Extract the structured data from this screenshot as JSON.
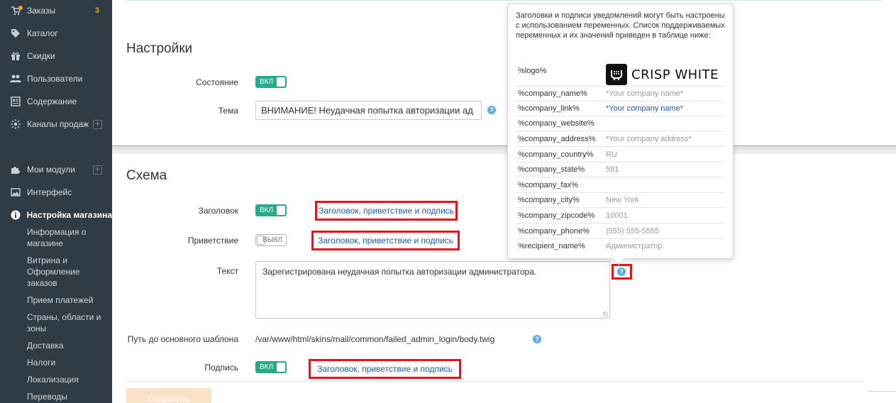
{
  "sidebar": {
    "items": [
      {
        "label": "Заказы",
        "icon": "orders-icon",
        "badge": "3"
      },
      {
        "label": "Каталог",
        "icon": "tag-icon"
      },
      {
        "label": "Скидки",
        "icon": "gift-icon"
      },
      {
        "label": "Пользователи",
        "icon": "users-icon"
      },
      {
        "label": "Содержание",
        "icon": "content-icon"
      },
      {
        "label": "Каналы продаж",
        "icon": "sales-channels-icon"
      },
      {
        "label": "Мои модули",
        "icon": "puzzle-icon"
      },
      {
        "label": "Интерфейс",
        "icon": "image-icon"
      },
      {
        "label": "Настройка магазина",
        "icon": "info-icon"
      }
    ],
    "subitems": [
      "Информация о магазине",
      "Витрина и Оформление заказов",
      "Прием платежей",
      "Страны, области и зоны",
      "Доставка",
      "Налоги",
      "Локализация",
      "Переводы"
    ],
    "plus": "+"
  },
  "settings": {
    "title": "Настройки",
    "state_label": "Состояние",
    "state_toggle": "ВКЛ",
    "subject_label": "Тема",
    "subject_value": "ВНИМАНИЕ! Неудачная попытка авторизации ад"
  },
  "schema": {
    "title": "Схема",
    "header_label": "Заголовок",
    "header_toggle": "ВКЛ",
    "header_link": "Заголовок, приветствие и подпись",
    "greeting_label": "Приветствие",
    "greeting_toggle": "ВЫКЛ",
    "greeting_link": "Заголовок, приветствие и подпись",
    "text_label": "Текст",
    "text_value": "Зарегистрирована неудачная попытка авторизации администратора.",
    "path_label": "Путь до основного шаблона",
    "path_value": "/var/www/html/skins/mail/common/failed_admin_login/body.twig",
    "signature_label": "Подпись",
    "signature_toggle": "ВКЛ",
    "signature_link": "Заголовок, приветствие и подпись"
  },
  "help_glyph": "?",
  "save_label": "Сохранить",
  "popover": {
    "description": "Заголовки и подписи уведомлений могут быть настроены с использованием переменных. Список поддерживаемых переменных и их значений приведен в таблице ниже:",
    "logo_var": "%logo%",
    "logo_text": "CRISP WHITE",
    "vars": [
      {
        "key": "%company_name%",
        "value": "*Your company name*"
      },
      {
        "key": "%company_link%",
        "value": "*Your company name*"
      },
      {
        "key": "%company_website%",
        "value": ""
      },
      {
        "key": "%company_address%",
        "value": "*Your company address*"
      },
      {
        "key": "%company_country%",
        "value": "RU"
      },
      {
        "key": "%company_state%",
        "value": "591"
      },
      {
        "key": "%company_fax%",
        "value": ""
      },
      {
        "key": "%company_city%",
        "value": "New York"
      },
      {
        "key": "%company_zipcode%",
        "value": "10001"
      },
      {
        "key": "%company_phone%",
        "value": "(555) 555-5555"
      },
      {
        "key": "%recipient_name%",
        "value": "Администратор"
      }
    ]
  },
  "colors": {
    "sidebar_bg": "#2f3b45",
    "toggle_on": "#27a98a",
    "link": "#1b5bab",
    "highlight": "#e8131a",
    "help": "#5aaee3"
  }
}
